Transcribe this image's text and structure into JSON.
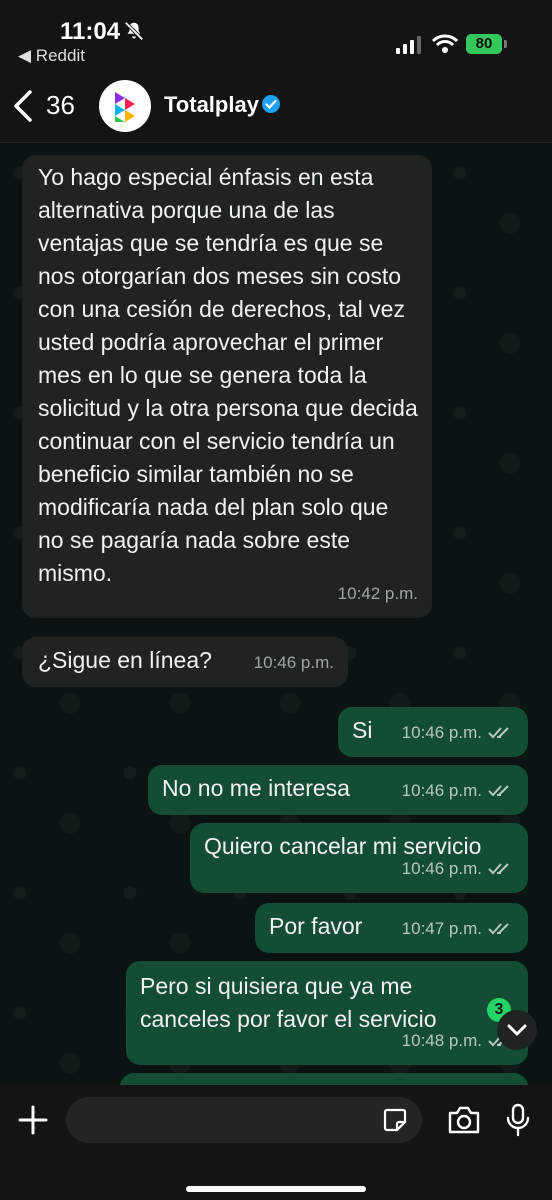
{
  "status_bar": {
    "time": "11:04",
    "back_app": "◀ Reddit",
    "battery": "80"
  },
  "header": {
    "back_count": "36",
    "name": "Totalplay"
  },
  "messages": [
    {
      "dir": "in",
      "text": "Yo hago especial énfasis en esta alternativa porque una de las ventajas que se tendría es que se nos otorgarían dos meses sin costo con una cesión de derechos, tal vez usted podría aprovechar el primer mes en lo que se genera toda la solicitud y la otra persona que decida continuar con el servicio tendría un beneficio similar también no se modificaría nada del plan solo que no se pagaría nada sobre este mismo.",
      "time": "10:42 p.m."
    },
    {
      "dir": "in",
      "text": "¿Sigue en línea?",
      "time": "10:46 p.m."
    },
    {
      "dir": "out",
      "text": "Si",
      "time": "10:46 p.m."
    },
    {
      "dir": "out",
      "text": "No no me interesa",
      "time": "10:46 p.m."
    },
    {
      "dir": "out",
      "text": "Quiero cancelar mi servicio",
      "time": "10:46 p.m."
    },
    {
      "dir": "out",
      "text": "Por favor",
      "time": "10:47 p.m."
    },
    {
      "dir": "out",
      "text": "Pero si quisiera que ya me canceles por favor el servicio",
      "time": "10:48 p.m."
    }
  ],
  "unread_count": "3",
  "composer": {
    "placeholder": ""
  },
  "colors": {
    "incoming": "#1f2421",
    "outgoing": "#124d34",
    "battery": "#34c759",
    "verified": "#1da1f2"
  }
}
